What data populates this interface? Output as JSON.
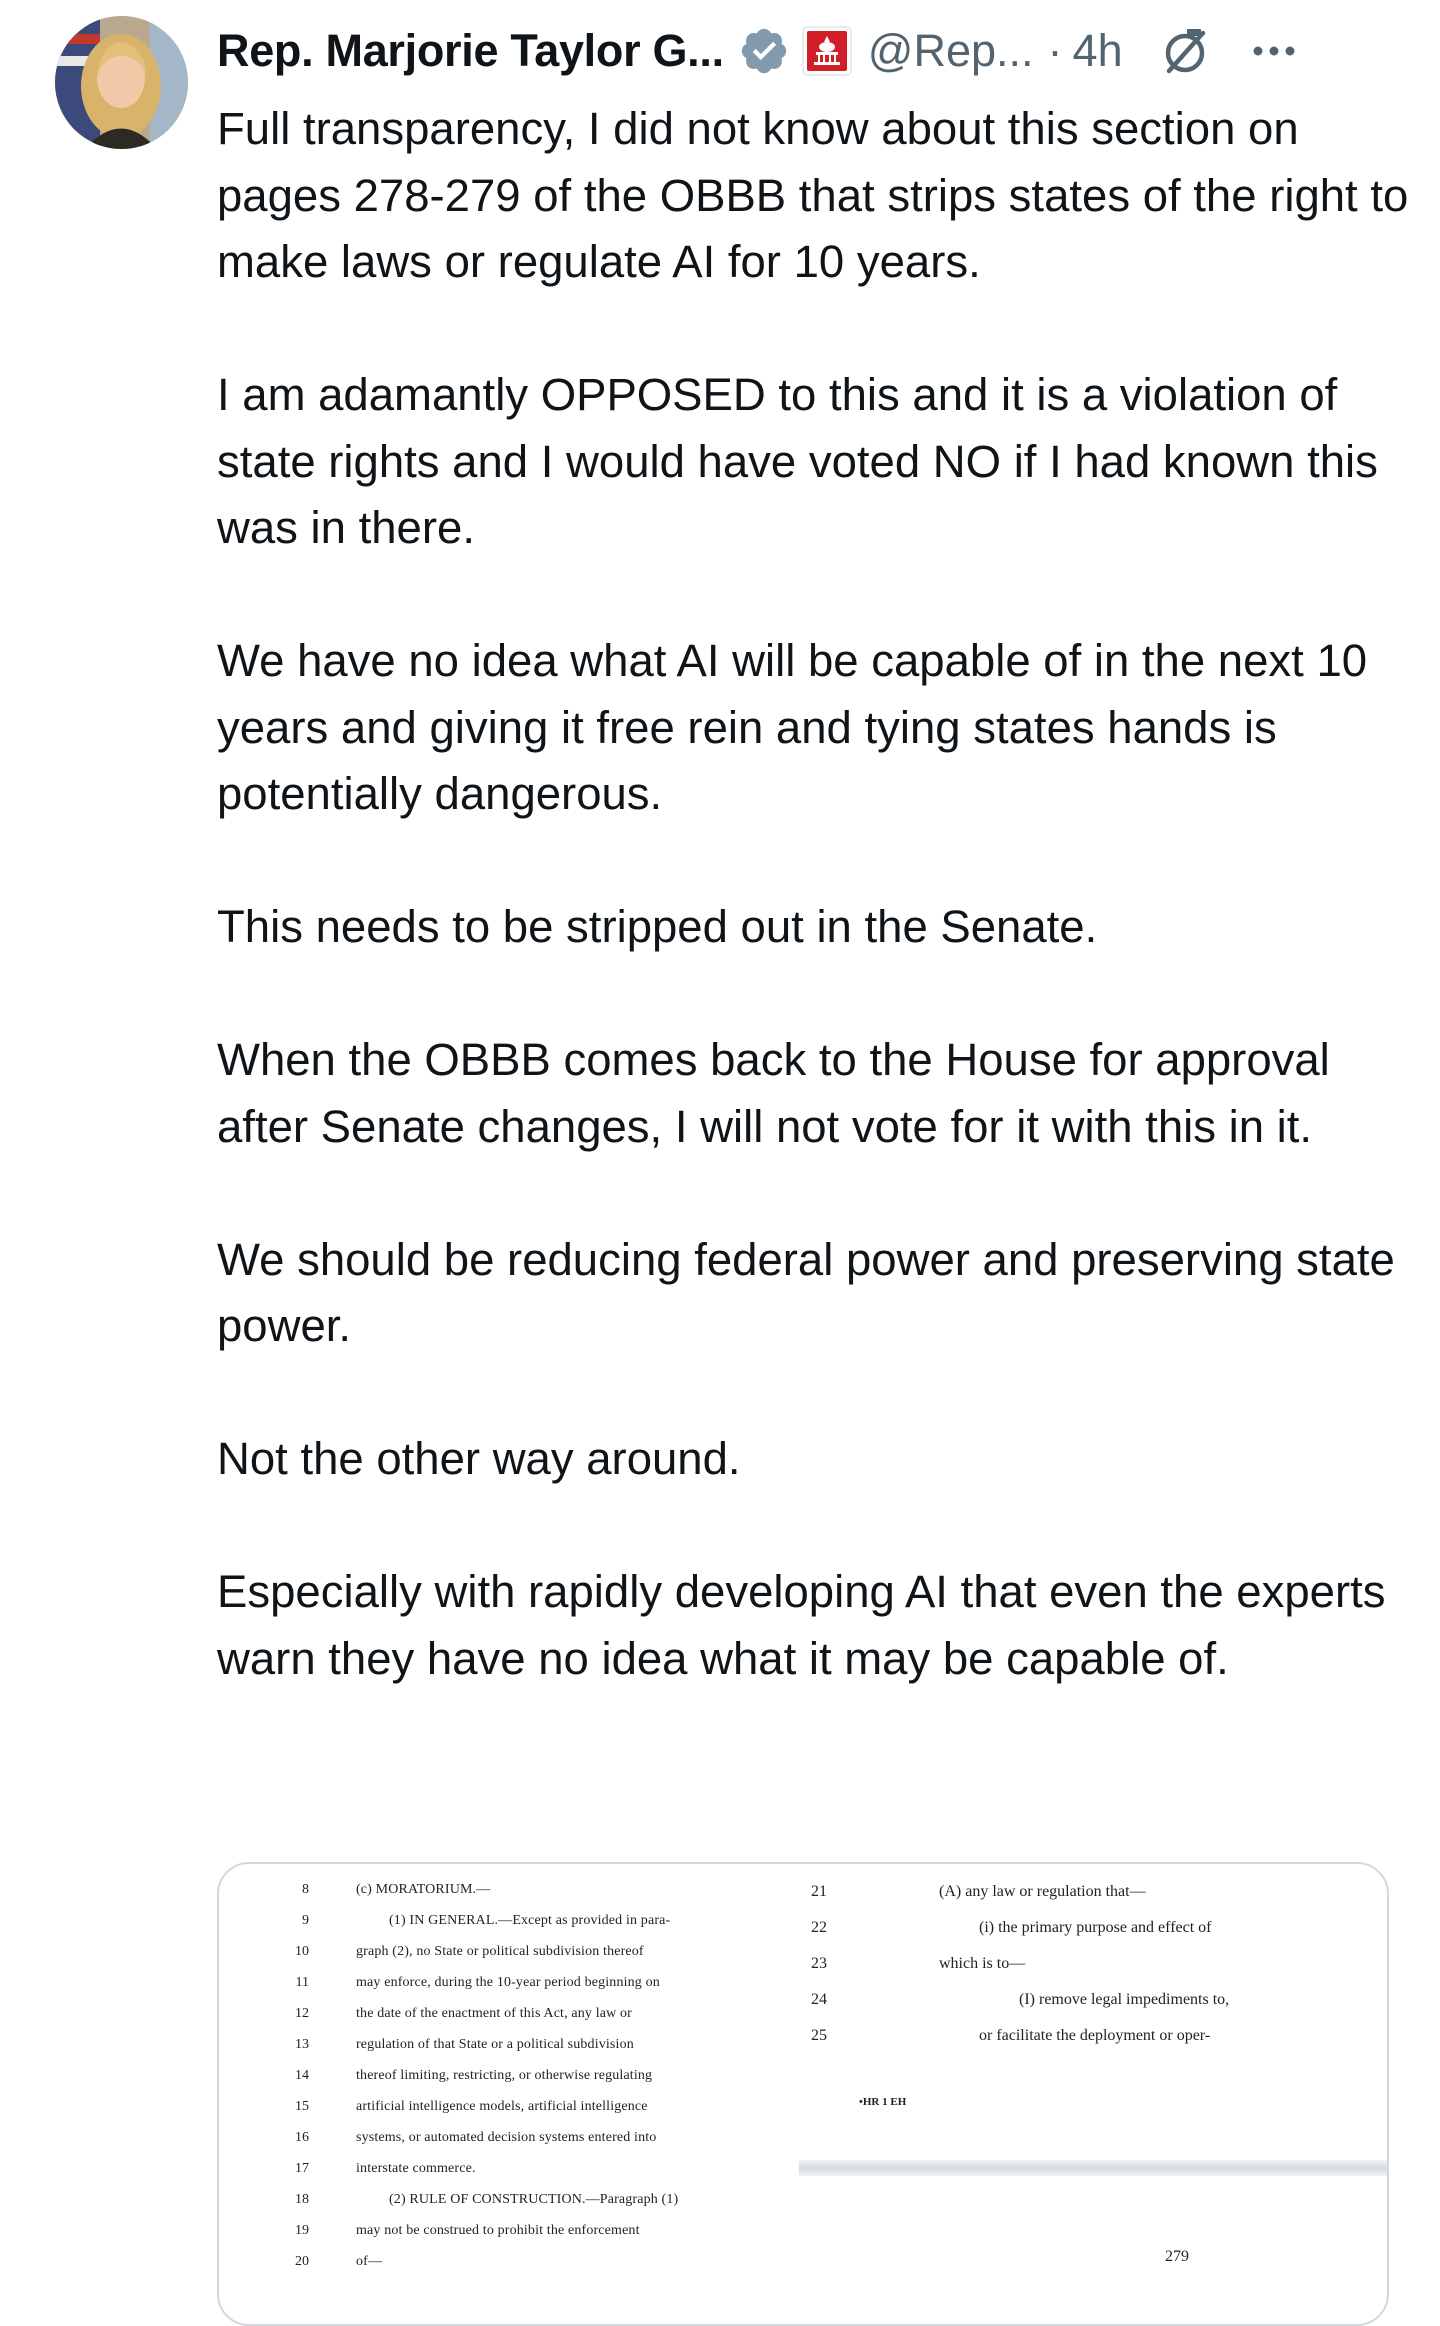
{
  "author": {
    "display_name": "Rep. Marjorie Taylor G...",
    "handle": "@Rep...",
    "separator": "·",
    "time": "4h",
    "verified_icon": "verified-badge-icon",
    "affiliation_icon": "capitol-gop-badge-icon"
  },
  "actions": {
    "grok_icon": "grok-slash-icon",
    "more_icon": "more-dots-icon"
  },
  "tweet": {
    "paragraphs": [
      "Full transparency, I did not know about this section on pages 278-279 of the OBBB that strips states of the right to make laws or regulate AI for 10 years.",
      "I am adamantly OPPOSED to this and it is a violation of state rights and I would have voted NO if I had known this was in there.",
      "We have no idea what AI will be capable of in the next 10 years and giving it free rein and tying states hands is potentially dangerous.",
      "This needs to be stripped out in the Senate.",
      "When the OBBB comes back to the House for approval after Senate changes, I will not vote for it with this in it.",
      "We should be reducing federal power and preserving state power.",
      "Not the other way around.",
      "Especially with rapidly developing AI that even the experts warn they have no idea what it may be capable of."
    ]
  },
  "media": {
    "left_page": {
      "lines": [
        {
          "num": "8",
          "text": "(c) MORATORIUM.—"
        },
        {
          "num": "9",
          "text": "(1) IN GENERAL.—Except as provided in para-"
        },
        {
          "num": "10",
          "text": "graph (2), no State or political subdivision thereof"
        },
        {
          "num": "11",
          "text": "may enforce, during the 10-year period beginning on"
        },
        {
          "num": "12",
          "text": "the date of the enactment of this Act, any law or"
        },
        {
          "num": "13",
          "text": "regulation of that State or a political subdivision"
        },
        {
          "num": "14",
          "text": "thereof limiting, restricting, or otherwise regulating"
        },
        {
          "num": "15",
          "text": "artificial intelligence models, artificial intelligence"
        },
        {
          "num": "16",
          "text": "systems, or automated decision systems entered into"
        },
        {
          "num": "17",
          "text": "interstate commerce."
        },
        {
          "num": "18",
          "text": "(2) RULE OF CONSTRUCTION.—Paragraph (1)"
        },
        {
          "num": "19",
          "text": "may not be construed to prohibit the enforcement"
        },
        {
          "num": "20",
          "text": "of—"
        }
      ]
    },
    "right_page": {
      "lines": [
        {
          "num": "21",
          "text": "(A) any law or regulation that—"
        },
        {
          "num": "22",
          "text": "(i) the primary purpose and effect of"
        },
        {
          "num": "23",
          "text": "which is to—"
        },
        {
          "num": "24",
          "text": "(I) remove legal impediments to,"
        },
        {
          "num": "25",
          "text": "or facilitate the deployment or oper-"
        }
      ],
      "footer_mark": "•HR 1 EH",
      "page_number": "279"
    }
  }
}
